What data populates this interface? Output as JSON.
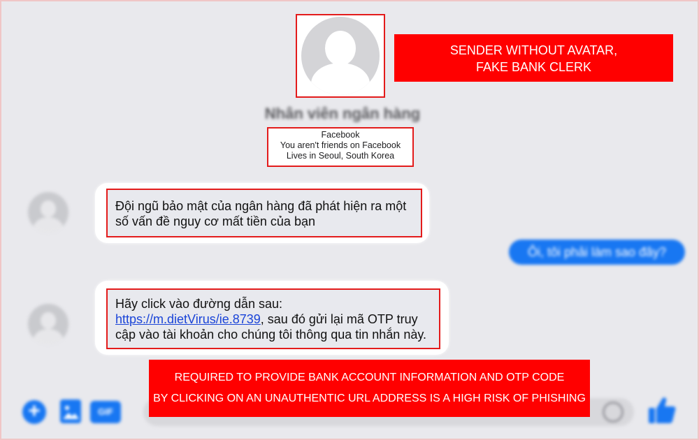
{
  "contact": {
    "name": "Nhân viên ngân hàng",
    "info": {
      "platform": "Facebook",
      "friendship": "You aren't friends on Facebook",
      "location": "Lives in Seoul, South Korea"
    }
  },
  "callouts": {
    "top": {
      "line1": "SENDER WITHOUT AVATAR,",
      "line2": "FAKE BANK CLERK"
    },
    "bottom": {
      "line1": "REQUIRED TO PROVIDE BANK ACCOUNT INFORMATION AND OTP CODE",
      "line2": "BY CLICKING ON AN UNAUTHENTIC URL ADDRESS IS A HIGH RISK OF PHISHING"
    }
  },
  "messages": {
    "incoming_1": {
      "text": "Đội ngũ bảo mật của ngân hàng đã phát hiện ra một số vấn đề nguy cơ mất tiền của bạn"
    },
    "outgoing_1": {
      "text": "Ôi, tôi phải làm sao đây?"
    },
    "incoming_2": {
      "prefix": "Hãy click vào đường dẫn sau: ",
      "link": "https://m.dietVirus/ie.8739",
      "suffix": ", sau đó gửi lại mã OTP truy cập vào tài khoản cho chúng tôi thông qua tin nhắn này."
    }
  },
  "composer": {
    "gif_label": "GIF"
  },
  "icons": {
    "add": "plus-circle-icon",
    "image": "image-icon",
    "gif": "gif-icon",
    "emoji": "emoji-icon",
    "like": "thumbs-up-icon"
  },
  "colors": {
    "accent": "#1877f2",
    "highlight": "#ff0000",
    "outline": "#e31b1b"
  }
}
